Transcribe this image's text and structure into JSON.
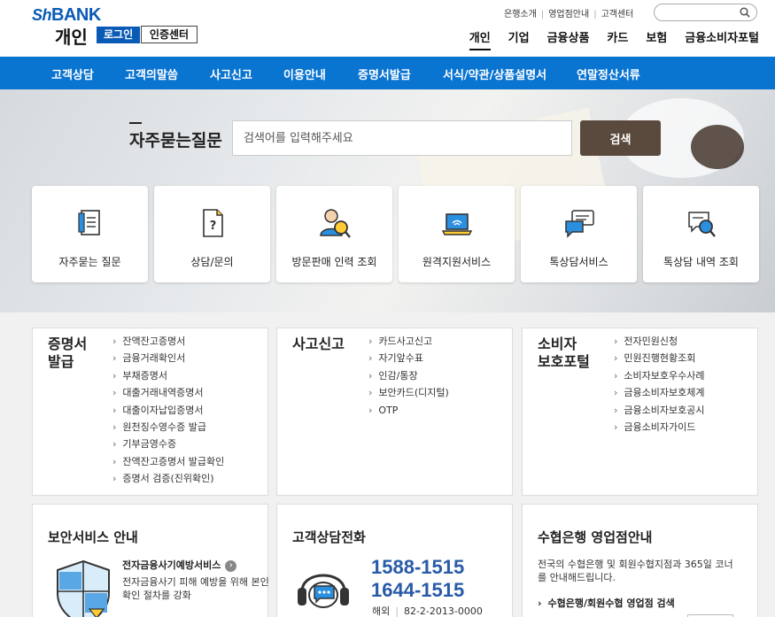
{
  "header": {
    "logo_prefix": "Sh",
    "logo_text": "BANK",
    "section": "개인",
    "login_label": "로그인",
    "cert_label": "인증센터",
    "util_links": [
      "은행소개",
      "영업점안내",
      "고객센터"
    ],
    "search_placeholder": "",
    "gnb": [
      "개인",
      "기업",
      "금융상품",
      "카드",
      "보험",
      "금융소비자포털"
    ]
  },
  "menubar": [
    "고객상담",
    "고객의말씀",
    "사고신고",
    "이용안내",
    "증명서발급",
    "서식/약관/상품설명서",
    "연말정산서류"
  ],
  "hero": {
    "faq_title": "자주묻는질문",
    "faq_placeholder": "검색어를 입력해주세요",
    "faq_button": "검색",
    "quick_links": [
      {
        "label": "자주묻는 질문",
        "icon": "faq-book-icon"
      },
      {
        "label": "상담/문의",
        "icon": "question-document-icon"
      },
      {
        "label": "방문판매 인력 조회",
        "icon": "person-search-icon"
      },
      {
        "label": "원격지원서비스",
        "icon": "remote-laptop-icon"
      },
      {
        "label": "톡상담서비스",
        "icon": "chat-bubble-icon"
      },
      {
        "label": "톡상담 내역 조회",
        "icon": "chat-search-icon"
      }
    ]
  },
  "panels": {
    "certificates": {
      "title_line1": "증명서",
      "title_line2": "발급",
      "items": [
        "잔액잔고증명서",
        "금융거래확인서",
        "부채증명서",
        "대출거래내역증명서",
        "대출이자납입증명서",
        "원천징수영수증 발급",
        "기부금영수증",
        "잔액잔고증명서 발급확인",
        "증명서 검증(진위확인)"
      ]
    },
    "accident": {
      "title": "사고신고",
      "items": [
        "카드사고신고",
        "자기앞수표",
        "인감/통장",
        "보안카드(디지털)",
        "OTP"
      ]
    },
    "consumer": {
      "title_line1": "소비자",
      "title_line2": "보호포털",
      "items": [
        "전자민원신청",
        "민원진행현황조회",
        "소비자보호우수사례",
        "금융소비자보호체계",
        "금융소비자보호공시",
        "금융소비자가이드"
      ]
    },
    "security": {
      "title": "보안서비스 안내",
      "link": "전자금융사기예방서비스",
      "desc": "전자금융사기 피해 예방을 위해 본인확인 절차를 강화"
    },
    "callcenter": {
      "title": "고객상담전화",
      "tel1": "1588-1515",
      "tel2": "1644-1515",
      "overseas_label": "해외",
      "overseas_tel": "82-2-2013-0000"
    },
    "branches": {
      "title": "수협은행 영업점안내",
      "desc": "전국의 수협은행 및 회원수협지점과 365일 코너를 안내해드립니다.",
      "link": "수협은행/회원수협 영업점 검색"
    }
  },
  "colors": {
    "brand_blue": "#0a74d1",
    "logo_blue": "#0a5bb5",
    "tel_blue": "#285aa8",
    "search_button": "#5a4a3d"
  }
}
